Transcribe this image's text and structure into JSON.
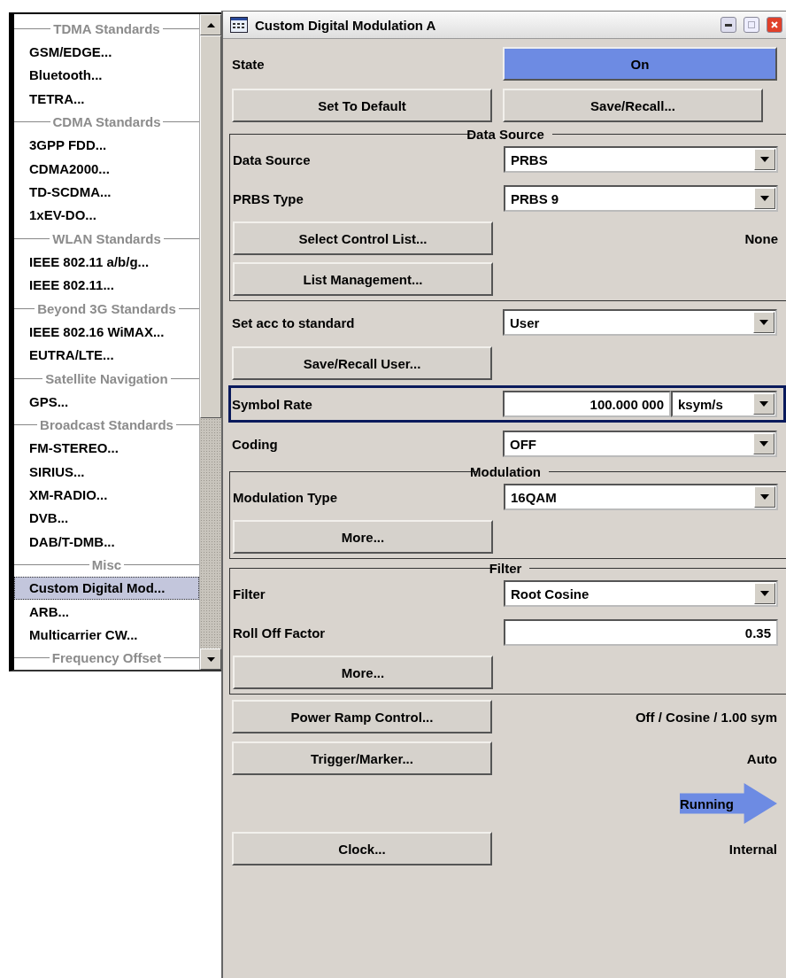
{
  "menu": {
    "items": [
      {
        "kind": "header",
        "label": "TDMA Standards"
      },
      {
        "kind": "item",
        "label": "GSM/EDGE...",
        "selected": false
      },
      {
        "kind": "item",
        "label": "Bluetooth...",
        "selected": false
      },
      {
        "kind": "item",
        "label": "TETRA...",
        "selected": false
      },
      {
        "kind": "header",
        "label": "CDMA Standards"
      },
      {
        "kind": "item",
        "label": "3GPP FDD...",
        "selected": false
      },
      {
        "kind": "item",
        "label": "CDMA2000...",
        "selected": false
      },
      {
        "kind": "item",
        "label": "TD-SCDMA...",
        "selected": false
      },
      {
        "kind": "item",
        "label": "1xEV-DO...",
        "selected": false
      },
      {
        "kind": "header",
        "label": "WLAN Standards"
      },
      {
        "kind": "item",
        "label": "IEEE 802.11 a/b/g...",
        "selected": false
      },
      {
        "kind": "item",
        "label": "IEEE 802.11...",
        "selected": false
      },
      {
        "kind": "header",
        "label": "Beyond 3G Standards"
      },
      {
        "kind": "item",
        "label": "IEEE 802.16 WiMAX...",
        "selected": false
      },
      {
        "kind": "item",
        "label": "EUTRA/LTE...",
        "selected": false
      },
      {
        "kind": "header",
        "label": "Satellite Navigation"
      },
      {
        "kind": "item",
        "label": "GPS...",
        "selected": false
      },
      {
        "kind": "header",
        "label": "Broadcast Standards"
      },
      {
        "kind": "item",
        "label": "FM-STEREO...",
        "selected": false
      },
      {
        "kind": "item",
        "label": "SIRIUS...",
        "selected": false
      },
      {
        "kind": "item",
        "label": "XM-RADIO...",
        "selected": false
      },
      {
        "kind": "item",
        "label": "DVB...",
        "selected": false
      },
      {
        "kind": "item",
        "label": "DAB/T-DMB...",
        "selected": false
      },
      {
        "kind": "header",
        "label": "Misc"
      },
      {
        "kind": "item",
        "label": "Custom Digital Mod...",
        "selected": true
      },
      {
        "kind": "item",
        "label": "ARB...",
        "selected": false
      },
      {
        "kind": "item",
        "label": "Multicarrier CW...",
        "selected": false
      },
      {
        "kind": "header",
        "label": "Frequency Offset"
      }
    ]
  },
  "window": {
    "title": "Custom Digital Modulation A",
    "rows": [
      {
        "kind": "toggle",
        "label": "State",
        "value": "On",
        "on": true
      },
      {
        "kind": "button_pair",
        "buttons": [
          "Set To Default",
          "Save/Recall..."
        ]
      },
      {
        "kind": "group",
        "title": "Data Source",
        "rows": [
          {
            "kind": "select",
            "label": "Data Source",
            "value": "PRBS"
          },
          {
            "kind": "select",
            "label": "PRBS Type",
            "value": "PRBS 9"
          },
          {
            "kind": "button_value",
            "button": "Select Control List...",
            "value": "None"
          },
          {
            "kind": "button",
            "button": "List Management..."
          }
        ]
      },
      {
        "kind": "select",
        "label": "Set acc to standard",
        "value": "User"
      },
      {
        "kind": "button",
        "button": "Save/Recall User..."
      },
      {
        "kind": "numeric",
        "label": "Symbol Rate",
        "value": "100.000 000",
        "unit": "ksym/s",
        "focused": true
      },
      {
        "kind": "select",
        "label": "Coding",
        "value": "OFF"
      },
      {
        "kind": "group",
        "title": "Modulation",
        "rows": [
          {
            "kind": "select",
            "label": "Modulation Type",
            "value": "16QAM"
          },
          {
            "kind": "button",
            "button": "More..."
          }
        ]
      },
      {
        "kind": "group",
        "title": "Filter",
        "rows": [
          {
            "kind": "select",
            "label": "Filter",
            "value": "Root Cosine"
          },
          {
            "kind": "field",
            "label": "Roll Off Factor",
            "value": "0.35"
          },
          {
            "kind": "button",
            "button": "More..."
          }
        ]
      },
      {
        "kind": "button_value",
        "button": "Power Ramp Control...",
        "value": "Off / Cosine / 1.00 sym"
      },
      {
        "kind": "button_value",
        "button": "Trigger/Marker...",
        "value": "Auto"
      },
      {
        "kind": "status",
        "value": "Running"
      },
      {
        "kind": "button_value",
        "button": "Clock...",
        "value": "Internal"
      }
    ]
  }
}
